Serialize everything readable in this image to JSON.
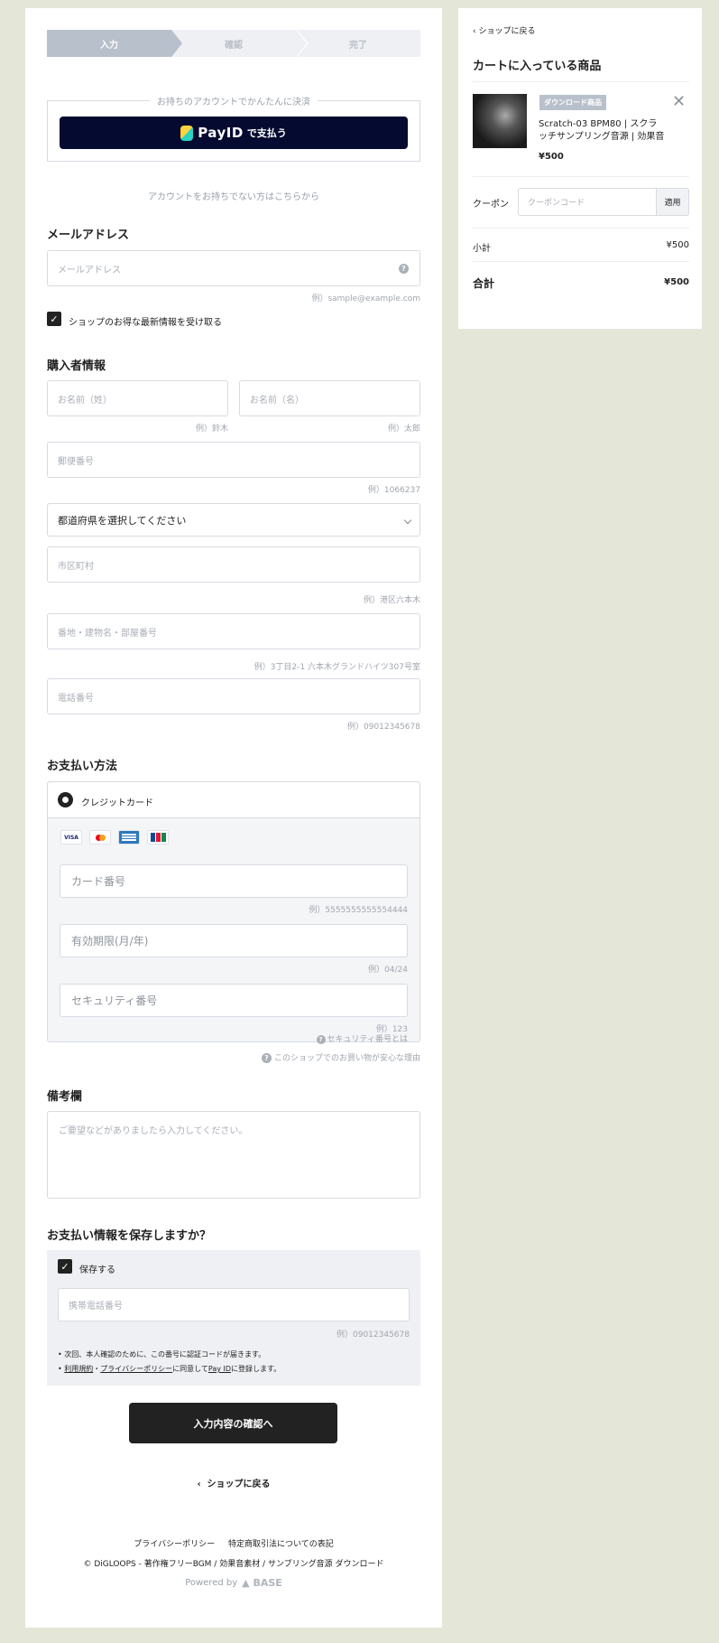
{
  "steps": [
    "入力",
    "確認",
    "完了"
  ],
  "payid": {
    "section_label": "お持ちのアカウントでかんたんに決済",
    "button_brand": "PayID",
    "button_suffix": "で支払う",
    "no_account_link": "アカウントをお持ちでない方はこちらから"
  },
  "email": {
    "title": "メールアドレス",
    "placeholder": "メールアドレス",
    "hint": "例）sample@example.com",
    "newsletter_label": "ショップのお得な最新情報を受け取る"
  },
  "buyer": {
    "title": "購入者情報",
    "last_name_placeholder": "お名前（姓）",
    "last_name_hint": "例）鈴木",
    "first_name_placeholder": "お名前（名）",
    "first_name_hint": "例）太郎",
    "zip_placeholder": "郵便番号",
    "zip_hint": "例）1066237",
    "prefecture_value": "都道府県を選択してください",
    "city_placeholder": "市区町村",
    "city_hint": "例）港区六本木",
    "address_placeholder": "番地・建物名・部屋番号",
    "address_hint": "例）3丁目2-1 六本木グランドハイツ307号室",
    "phone_placeholder": "電話番号",
    "phone_hint": "例）09012345678"
  },
  "payment": {
    "title": "お支払い方法",
    "method_label": "クレジットカード",
    "card_brands": [
      "VISA",
      "MC",
      "AMEX",
      "JCB"
    ],
    "card_number_placeholder": "カード番号",
    "card_number_hint": "例）5555555555554444",
    "expiry_placeholder": "有効期限(月/年)",
    "expiry_hint": "例）04/24",
    "cvc_placeholder": "セキュリティ番号",
    "cvc_hint": "例）123",
    "cvc_help": "セキュリティ番号とは",
    "safe_link": "このショップでのお買い物が安心な理由"
  },
  "notes": {
    "title": "備考欄",
    "placeholder": "ご要望などがありましたら入力してください。"
  },
  "save": {
    "title": "お支払い情報を保存しますか？",
    "checkbox_label": "保存する",
    "phone_placeholder": "携帯電話番号",
    "phone_hint": "例）09012345678",
    "bullet1": "次回、本人確認のために、この番号に認証コードが届きます。",
    "bullet2_terms": "利用規約",
    "bullet2_sep": "・",
    "bullet2_privacy": "プライバシーポリシー",
    "bullet2_mid": "に同意して",
    "bullet2_payid": "Pay ID",
    "bullet2_end": "に登録します。"
  },
  "confirm_button": "入力内容の確認へ",
  "back_to_shop": "ショップに戻る",
  "footer": {
    "privacy": "プライバシーポリシー",
    "tokushoho": "特定商取引法についての表記",
    "copyright": "© DiGLOOPS - 著作権フリーBGM / 効果音素材 / サンプリング音源 ダウンロード",
    "powered": "Powered by",
    "base_logo": "BASE"
  },
  "cart": {
    "back": "ショップに戻る",
    "title": "カートに入っている商品",
    "item_badge": "ダウンロード商品",
    "item_name": "Scratch-03 BPM80 | スクラッチサンプリング音源 | 効果音",
    "item_price": "¥500",
    "coupon_label": "クーポン",
    "coupon_placeholder": "クーポンコード",
    "coupon_button": "適用",
    "subtotal_label": "小計",
    "subtotal_value": "¥500",
    "total_label": "合計",
    "total_value": "¥500"
  }
}
